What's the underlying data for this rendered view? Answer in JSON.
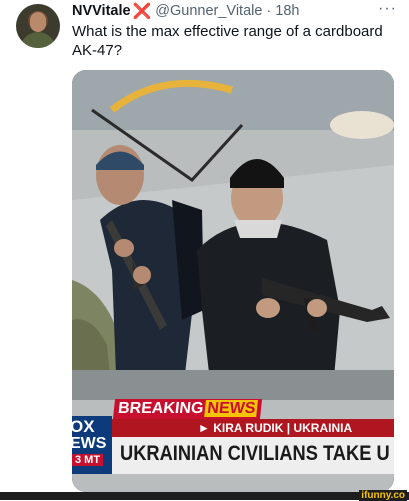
{
  "tweet": {
    "display_name": "NVVitale",
    "badge": "❌",
    "handle": "@Gunner_Vitale",
    "separator": "·",
    "time": "18h",
    "more": "···",
    "text": "What is the max effective range of a cardboard AK-47?"
  },
  "media": {
    "breaking_label": "BREAKING",
    "news_label": "NEWS",
    "subline": "► KIRA RUDIK  |  UKRAINIA",
    "headline": "UKRAINIAN CIVILIANS TAKE U",
    "logo_line1": "OX",
    "logo_line2": "EWS",
    "logo_line3": "3 MT"
  },
  "watermark": "ifunny.co",
  "colors": {
    "breaking_red": "#c8102e",
    "news_yellow": "#f4c400",
    "fox_blue": "#0c3a7a",
    "ifunny_yellow": "#f7c400"
  }
}
